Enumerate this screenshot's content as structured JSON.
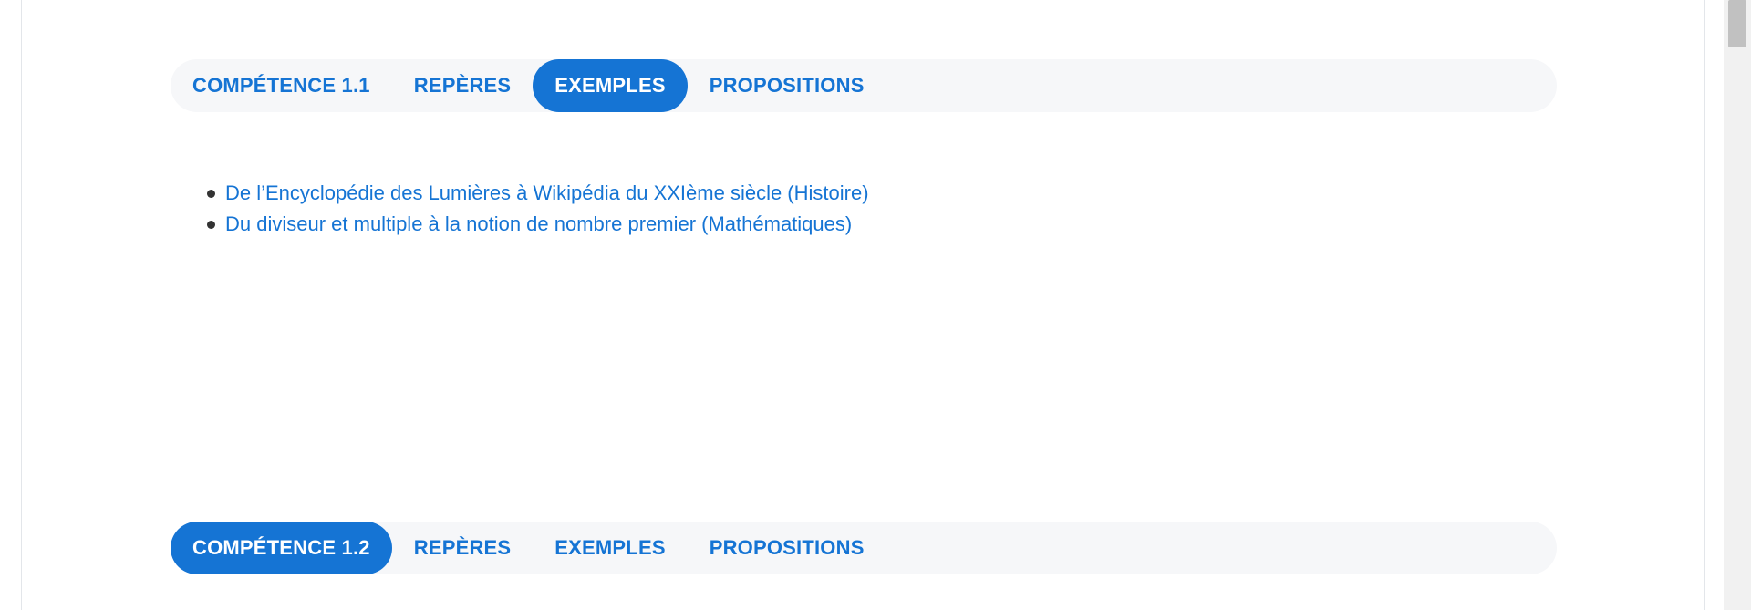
{
  "section_1": {
    "tabs": [
      {
        "label": "COMPÉTENCE 1.1",
        "active": false
      },
      {
        "label": "REPÈRES",
        "active": false
      },
      {
        "label": "EXEMPLES",
        "active": true
      },
      {
        "label": "PROPOSITIONS",
        "active": false
      }
    ],
    "examples": [
      {
        "label": "De l’Encyclopédie des Lumières à Wikipédia du XXIème siècle (Histoire)"
      },
      {
        "label": "Du diviseur et multiple à la notion de nombre premier (Mathématiques)"
      }
    ]
  },
  "section_2": {
    "tabs": [
      {
        "label": "COMPÉTENCE 1.2",
        "active": true
      },
      {
        "label": "REPÈRES",
        "active": false
      },
      {
        "label": "EXEMPLES",
        "active": false
      },
      {
        "label": "PROPOSITIONS",
        "active": false
      }
    ]
  },
  "colors": {
    "accent": "#1574d4",
    "tabbar_bg": "#f6f7f9",
    "bullet": "#333333"
  }
}
